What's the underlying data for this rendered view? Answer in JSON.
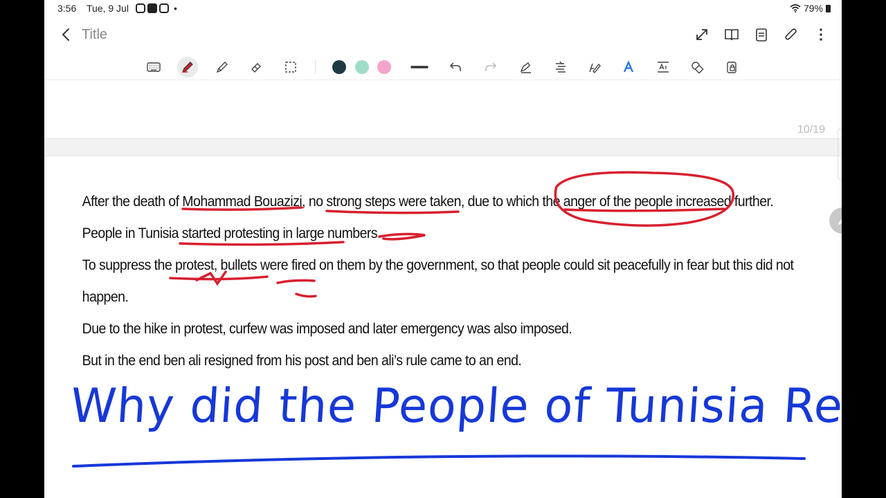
{
  "status": {
    "time": "3:56",
    "date": "Tue, 9 Jul",
    "dot": "•",
    "battery": "79%"
  },
  "appbar": {
    "title": "Title"
  },
  "toolbar": {
    "colors": [
      "#1f3a44",
      "#9fdcc8",
      "#f6a3cc"
    ],
    "icons": [
      "keyboard-icon",
      "pen-icon",
      "highlighter-icon",
      "eraser-icon",
      "lasso-select-icon",
      "line-thickness-icon",
      "undo-icon",
      "redo-icon",
      "shape-pen-icon",
      "align-text-icon",
      "text-pen-icon",
      "text-style-icon",
      "text-box-icon",
      "shapes-icon",
      "lock-icon"
    ]
  },
  "page": {
    "counter": "10/19",
    "lines": [
      "After the death of Mohammad Bouazizi, no strong steps were taken, due to which the anger of the people increased further.",
      "People in Tunisia started protesting in large numbers.",
      "To suppress the protest, bullets were fired on them by the government, so that people could sit peacefully in fear but this did not",
      "happen.",
      "Due to the hike in protest, curfew was imposed and later emergency was also imposed.",
      "But in the end ben ali resigned from his post and ben ali’s rule came to an end."
    ],
    "handwritten_heading": "Why did the People of Tunisia Revolt?",
    "annotation_color": "#d8202f",
    "heading_color": "#1638d8"
  }
}
